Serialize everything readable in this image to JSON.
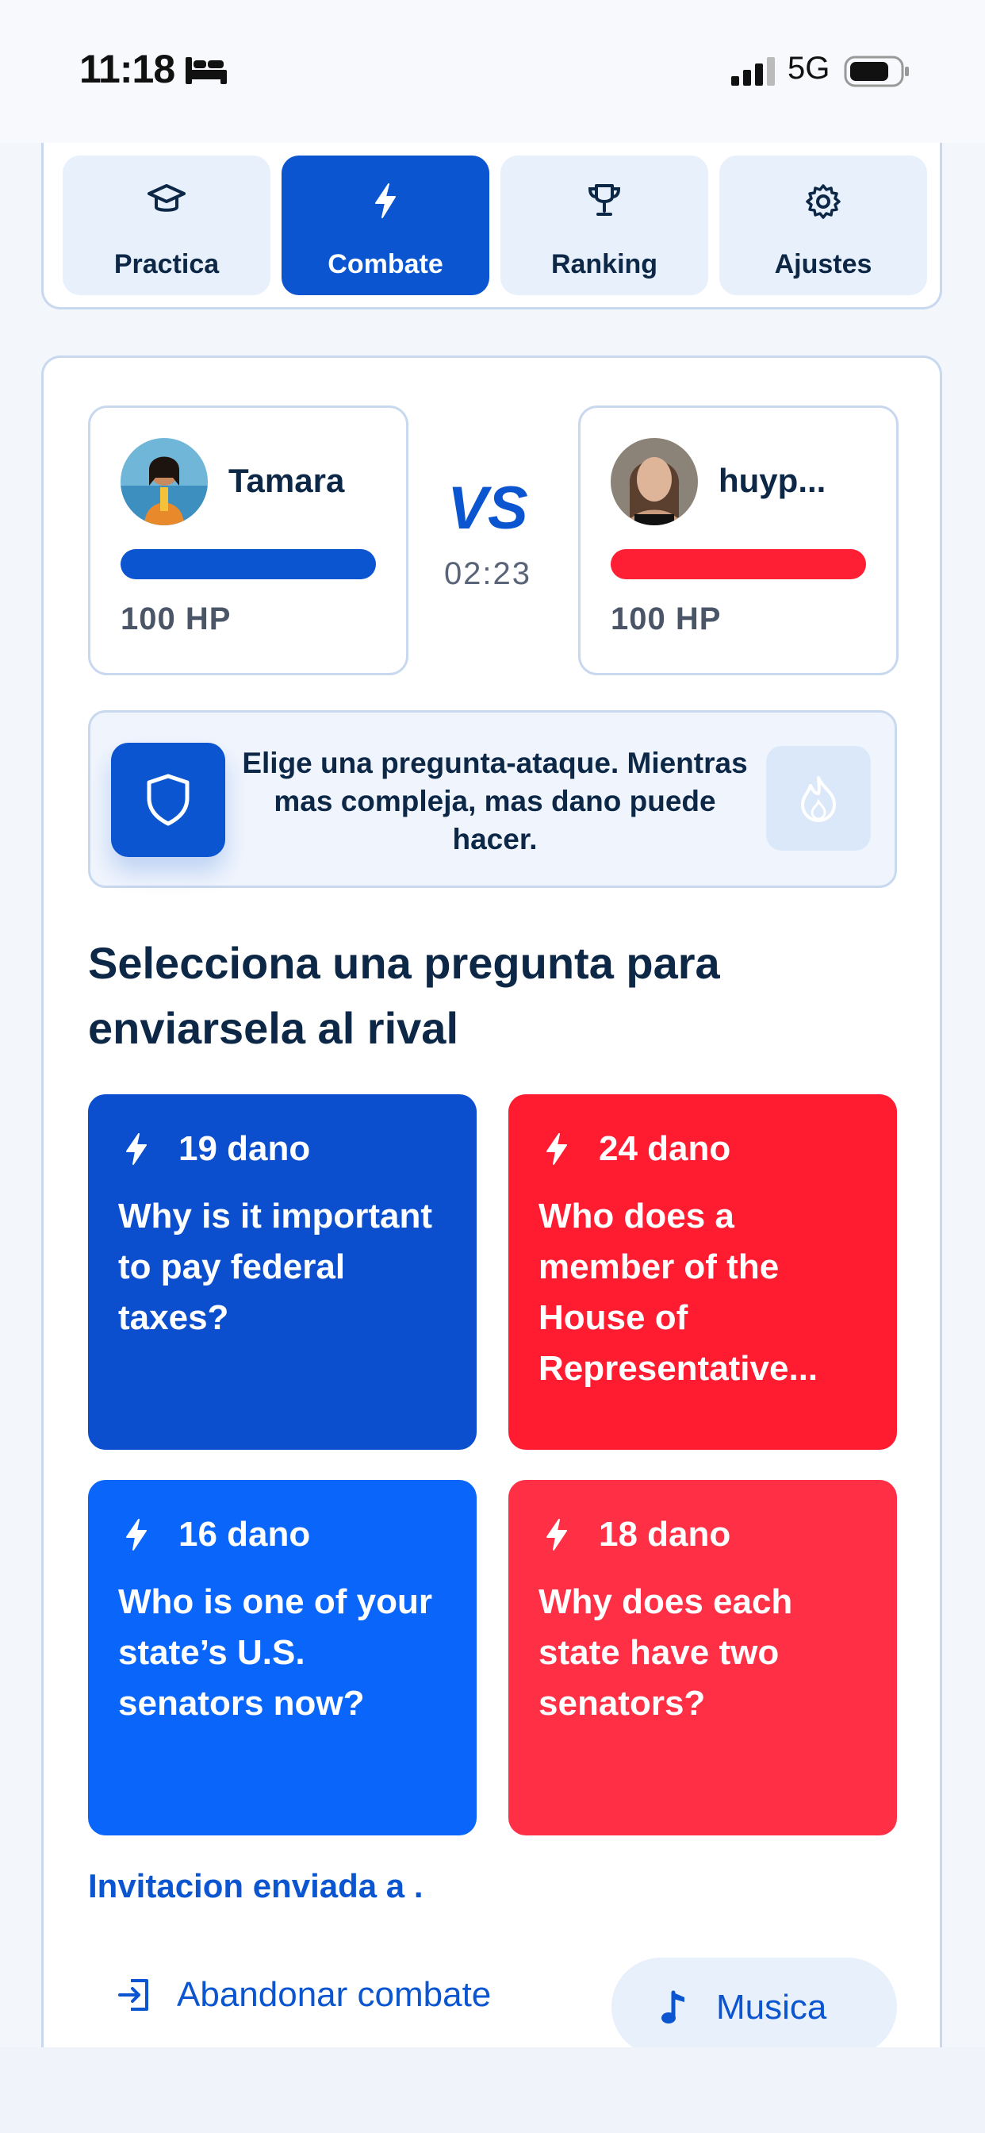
{
  "status_bar": {
    "time": "11:18",
    "network": "5G"
  },
  "nav": {
    "tabs": [
      {
        "label": "Practica",
        "icon": "graduation-cap-icon",
        "active": false
      },
      {
        "label": "Combate",
        "icon": "bolt-icon",
        "active": true
      },
      {
        "label": "Ranking",
        "icon": "trophy-icon",
        "active": false
      },
      {
        "label": "Ajustes",
        "icon": "gear-icon",
        "active": false
      }
    ]
  },
  "battle": {
    "player": {
      "name": "Tamara",
      "hp": "100 HP",
      "hp_fraction": 1.0,
      "color": "#0b55d0"
    },
    "opponent": {
      "name": "huyp...",
      "hp": "100 HP",
      "hp_fraction": 1.0,
      "color": "#ff1f35"
    },
    "vs": "VS",
    "timer": "02:23"
  },
  "hint": {
    "text": "Elige una pregunta-ataque. Mientras mas compleja, mas dano puede hacer."
  },
  "section_title": "Selecciona una pregunta para enviarsela al rival",
  "questions": [
    {
      "damage": "19 dano",
      "text": "Why is it important to pay federal taxes?",
      "color": "#0b4fcf"
    },
    {
      "damage": "24 dano",
      "text": "Who does a member of the House of Representative...",
      "color": "#ff1b30"
    },
    {
      "damage": "16 dano",
      "text": "Who is one of your state’s U.S. senators now?",
      "color": "#0a66fb"
    },
    {
      "damage": "18 dano",
      "text": "Why does each state have two senators?",
      "color": "#ff2f45"
    }
  ],
  "invite_text": "Invitacion enviada a .",
  "footer": {
    "leave_label": "Abandonar combate",
    "music_label": "Musica"
  }
}
